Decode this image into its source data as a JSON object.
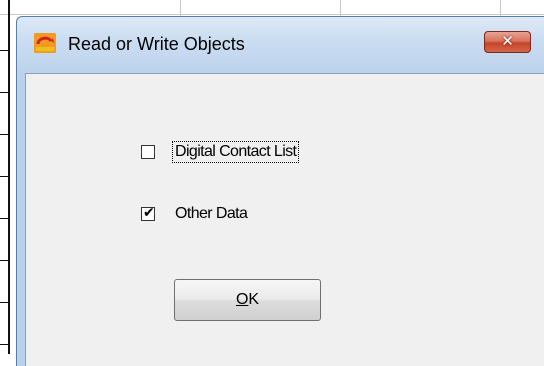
{
  "dialog": {
    "title": "Read or Write Objects",
    "icon": "app-logo-icon",
    "close_symbol": "✕",
    "accent_color": "#c4452a"
  },
  "options": [
    {
      "label": "Digital Contact List",
      "checked": false,
      "focused": true
    },
    {
      "label": "Other Data",
      "checked": true,
      "focused": false
    }
  ],
  "buttons": {
    "ok_mnemonic": "O",
    "ok_rest": "K"
  },
  "checkmark_symbol": "✔"
}
